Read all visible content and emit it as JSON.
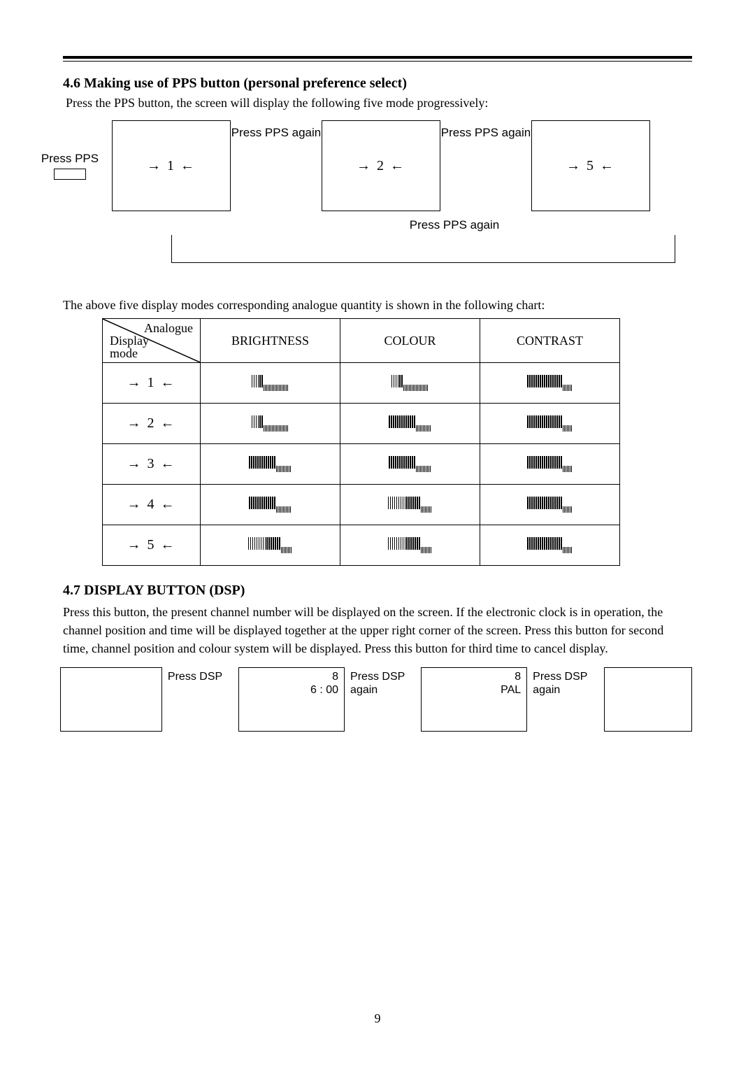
{
  "section46": {
    "heading": "4.6 Making use of PPS button (personal preference select)",
    "intro": "Press the PPS button, the screen will display the following five mode progressively:",
    "press_pps": "Press PPS",
    "press_again": "Press PPS again",
    "press_again_bottom": "Press PPS again",
    "screens": [
      "1",
      "2",
      "5"
    ]
  },
  "chart_intro": "The above five display modes corresponding analogue quantity is shown in the following chart:",
  "chart_header": {
    "diag_top": "Analogue",
    "diag_bottom_1": "Display",
    "diag_bottom_2": "mode",
    "brightness": "BRIGHTNESS",
    "colour": "COLOUR",
    "contrast": "CONTRAST"
  },
  "chart_data": {
    "type": "table",
    "title": "PPS display modes vs analogue quantity levels",
    "notes": "Values are approximate fill levels (0–1) of the bar indicator, read from the graphic bar widths in each cell.",
    "columns": [
      "BRIGHTNESS",
      "COLOUR",
      "CONTRAST"
    ],
    "rows": [
      {
        "mode": "1",
        "values": [
          0.25,
          0.25,
          0.7
        ]
      },
      {
        "mode": "2",
        "values": [
          0.25,
          0.55,
          0.7
        ]
      },
      {
        "mode": "3",
        "values": [
          0.55,
          0.55,
          0.7
        ]
      },
      {
        "mode": "4",
        "values": [
          0.55,
          0.65,
          0.7
        ]
      },
      {
        "mode": "5",
        "values": [
          0.65,
          0.65,
          0.7
        ]
      }
    ]
  },
  "section47": {
    "heading": "4.7 DISPLAY BUTTON (DSP)",
    "body": "Press this button, the present channel number will be displayed on the screen. If the electronic clock is in operation, the channel position and time will be displayed together at the upper right corner of the screen. Press this button for second time, channel position and colour system will be displayed. Press this button for third time to cancel display.",
    "press_dsp": "Press DSP",
    "press_dsp_again": "Press DSP again",
    "screen1_line1": "8",
    "screen1_line2": "6 : 00",
    "screen2_line1": "8",
    "screen2_line2": "PAL"
  },
  "page_number": "9"
}
